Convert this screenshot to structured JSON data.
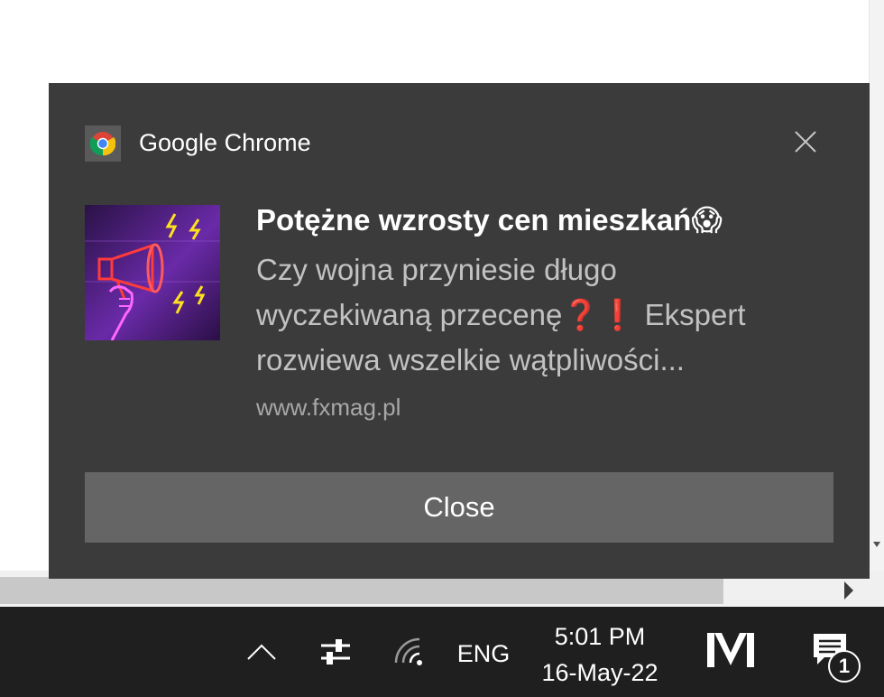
{
  "notification": {
    "app_name": "Google Chrome",
    "app_icon": "chrome-icon",
    "title": "Potężne wzrosty cen mieszkań😱",
    "body_lines": [
      "Czy wojna przyniesie długo",
      "wyczekiwaną przecenę❓❗ Ekspert",
      "rozwiewa wszelkie wątpliwości..."
    ],
    "source": "www.fxmag.pl",
    "image": "megaphone-image",
    "action_label": "Close",
    "dismiss_icon": "close-icon"
  },
  "taskbar": {
    "tray_icons": [
      "chevron-up-icon",
      "sliders-icon",
      "wifi-icon"
    ],
    "language": "ENG",
    "time": "5:01 PM",
    "date": "16-May-22",
    "app_icon": "m-logo-icon",
    "notification_count": "1"
  },
  "colors": {
    "toast_bg": "#3b3b3b",
    "action_bg": "#656565",
    "taskbar_bg": "#1f1f1f"
  }
}
